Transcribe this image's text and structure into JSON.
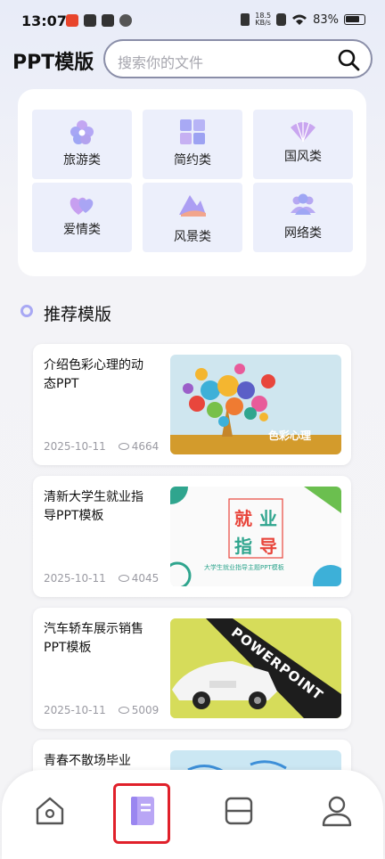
{
  "status_bar": {
    "time": "13:07",
    "battery": "83%",
    "net_speed_top": "18.5",
    "net_speed_bottom": "KB/s"
  },
  "header": {
    "title": "PPT模版",
    "search_placeholder": "搜索你的文件"
  },
  "categories": [
    {
      "label": "旅游类",
      "icon": "flower-icon"
    },
    {
      "label": "简约类",
      "icon": "grid-icon"
    },
    {
      "label": "国风类",
      "icon": "fan-icon"
    },
    {
      "label": "爱情类",
      "icon": "hearts-icon"
    },
    {
      "label": "风景类",
      "icon": "mountain-icon"
    },
    {
      "label": "网络类",
      "icon": "people-icon"
    }
  ],
  "section": {
    "title": "推荐模版"
  },
  "cards": [
    {
      "title": "介绍色彩心理的动态PPT",
      "date": "2025-10-11",
      "views": "4664",
      "thumb_text": "色彩心理"
    },
    {
      "title": "清新大学生就业指导PPT模板",
      "date": "2025-10-11",
      "views": "4045",
      "thumb_big": [
        "就",
        "业",
        "指",
        "导"
      ],
      "thumb_caption": "大学生就业指导主题PPT模板"
    },
    {
      "title": "汽车轿车展示销售PPT模板",
      "date": "2025-10-11",
      "views": "5009",
      "thumb_text": "POWERPOINT"
    },
    {
      "title": "青春不散场毕业",
      "date": "",
      "views": ""
    }
  ],
  "bottom_nav": {
    "items": [
      "home",
      "templates",
      "scan",
      "profile"
    ],
    "active": "templates"
  },
  "colors": {
    "accent": "#8b8ff7",
    "tile_bg": "#eef0fc",
    "highlight_box": "#e0202a"
  }
}
